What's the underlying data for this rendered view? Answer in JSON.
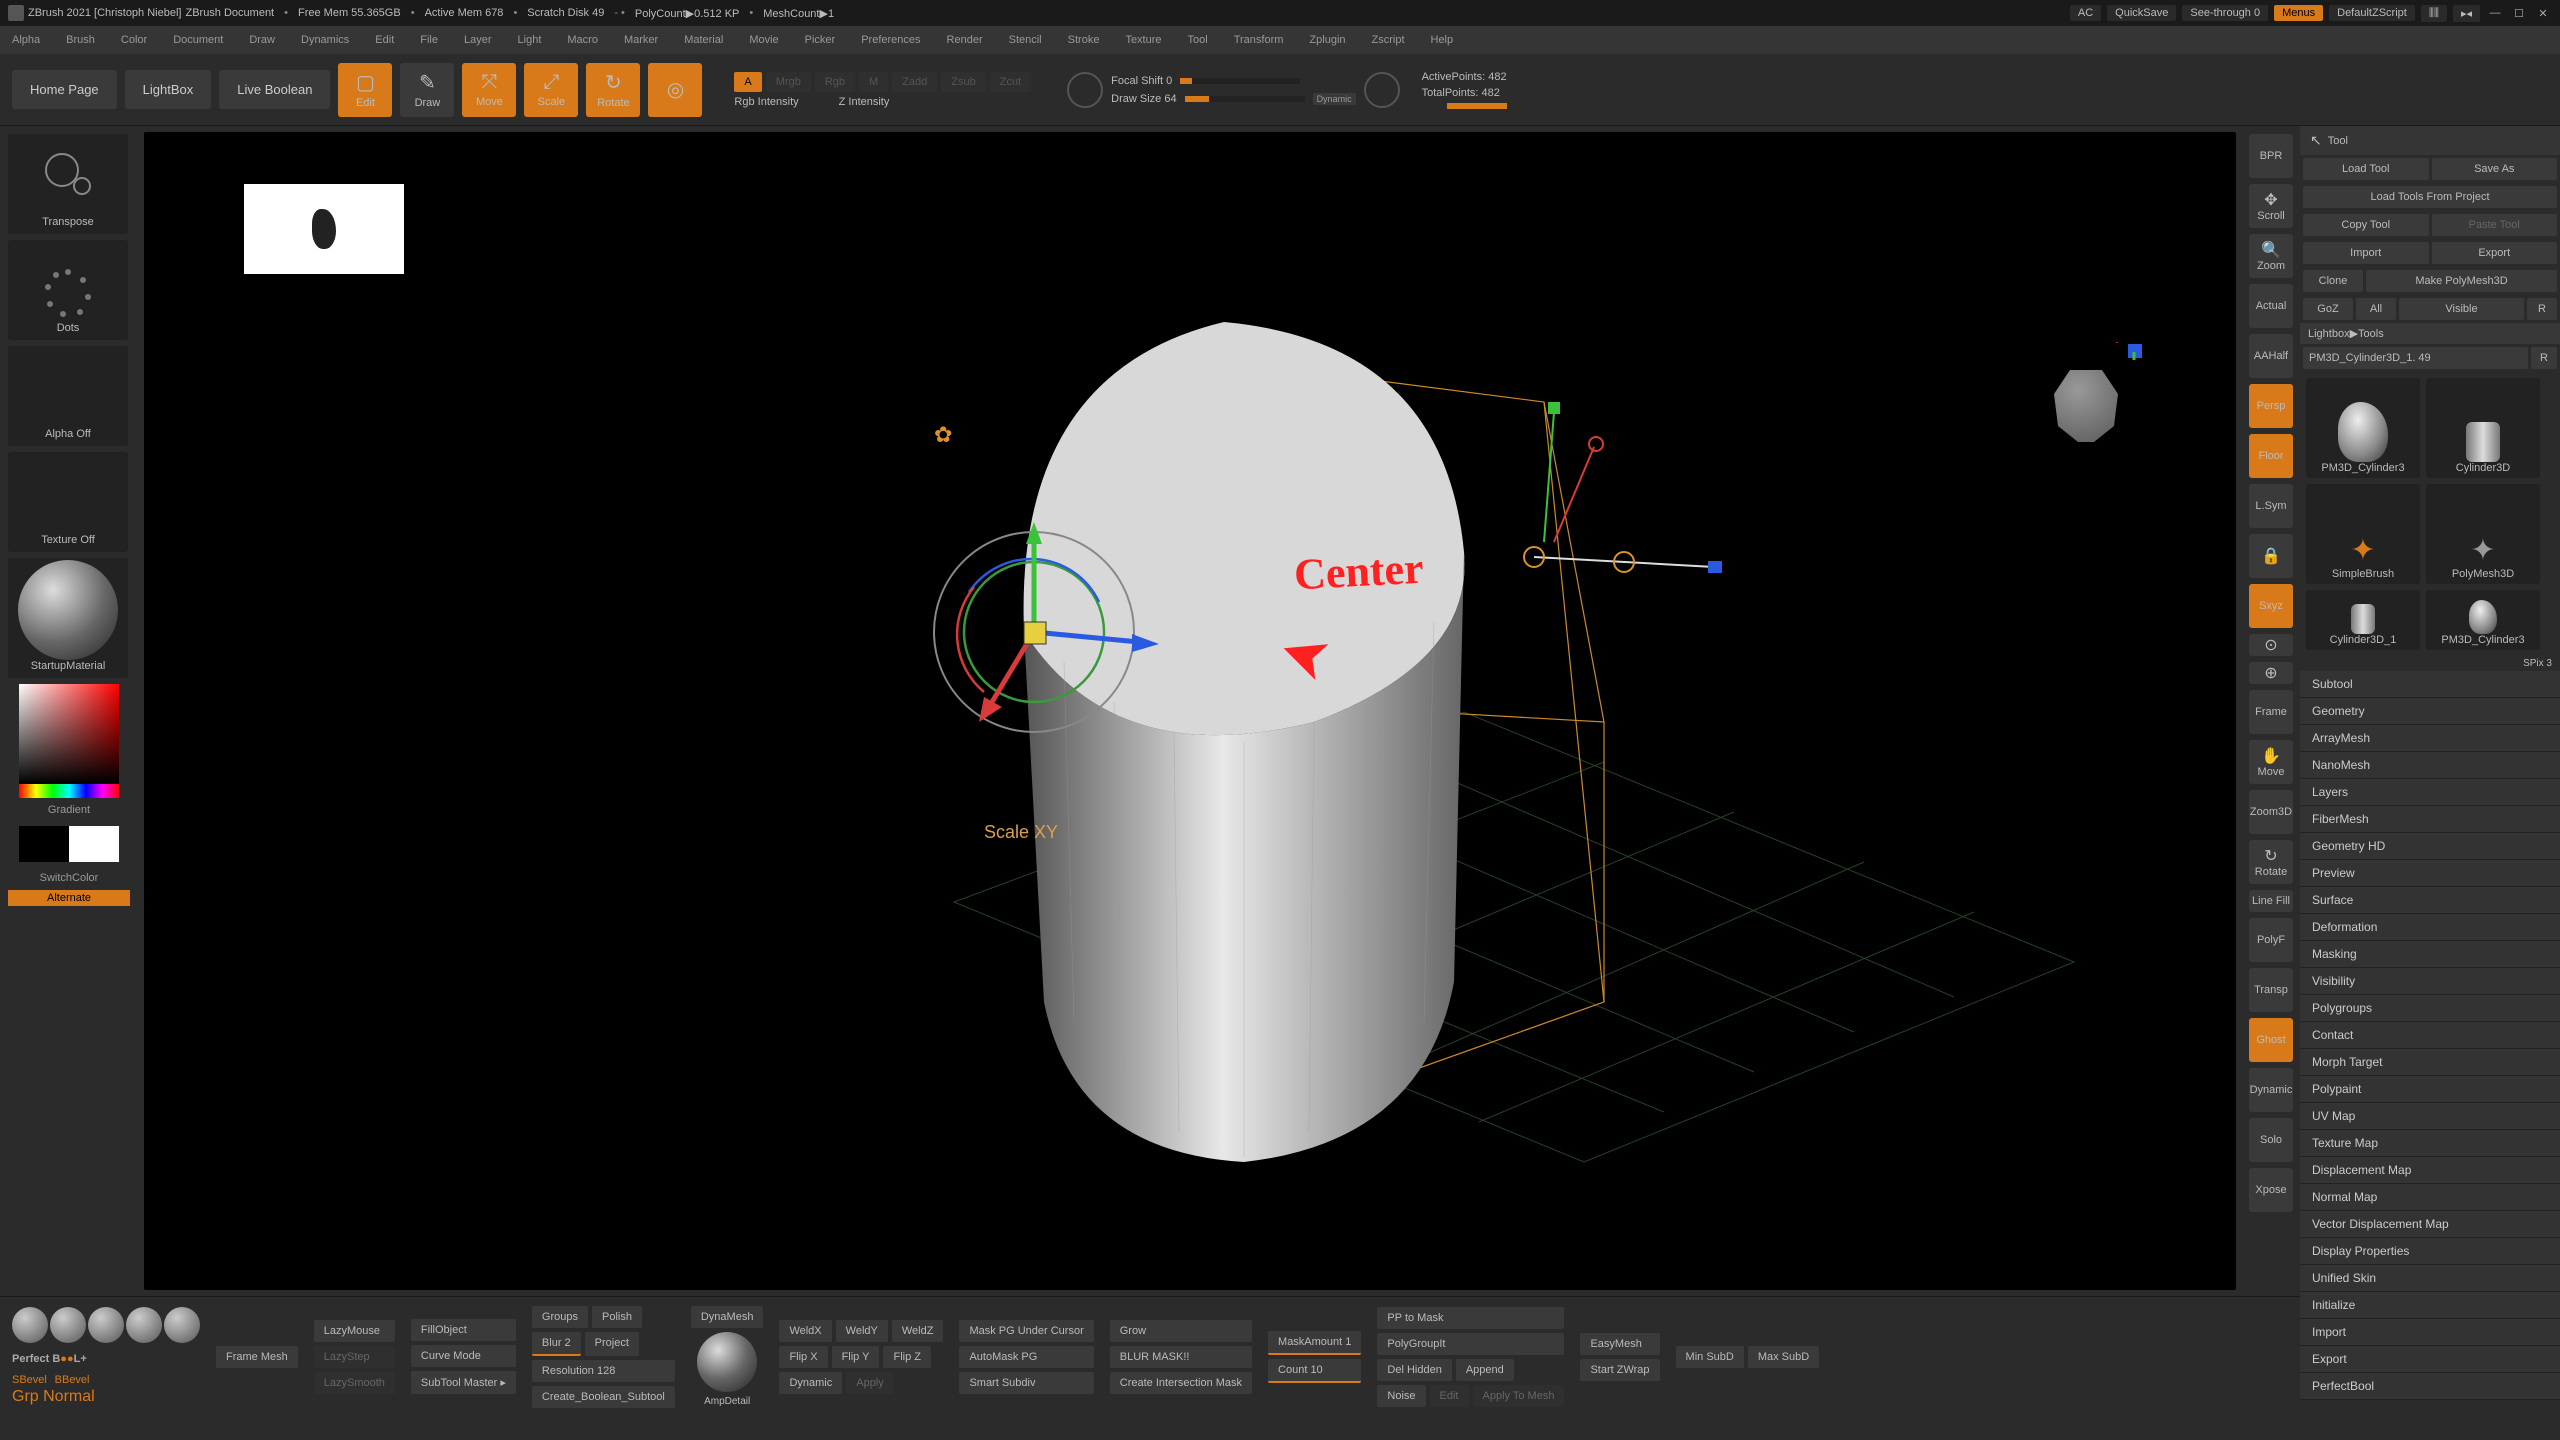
{
  "title": {
    "app": "ZBrush 2021 [Christoph Niebel]",
    "doc": "ZBrush Document",
    "freemem": "Free Mem 55.365GB",
    "activemem": "Active Mem 678",
    "scratch": "Scratch Disk 49",
    "polycount": "PolyCount▶0.512 KP",
    "meshcount": "MeshCount▶1",
    "ac": "AC",
    "quicksave": "QuickSave",
    "seethrough": "See-through  0",
    "menus": "Menus",
    "defaultscript": "DefaultZScript"
  },
  "menu": [
    "Alpha",
    "Brush",
    "Color",
    "Document",
    "Draw",
    "Dynamics",
    "Edit",
    "File",
    "Layer",
    "Light",
    "Macro",
    "Marker",
    "Material",
    "Movie",
    "Picker",
    "Preferences",
    "Render",
    "Stencil",
    "Stroke",
    "Texture",
    "Tool",
    "Transform",
    "Zplugin",
    "Zscript",
    "Help"
  ],
  "shelf": {
    "home": "Home Page",
    "lightbox": "LightBox",
    "liveboolean": "Live Boolean",
    "edit": "Edit",
    "draw": "Draw",
    "move": "Move",
    "scale": "Scale",
    "rotate": "Rotate",
    "gizmo": "⊙",
    "a": "A",
    "mrgb": "Mrgb",
    "rgb": "Rgb",
    "m": "M",
    "zadd": "Zadd",
    "zsub": "Zsub",
    "zcut": "Zcut",
    "rgbint": "Rgb Intensity",
    "zint": "Z Intensity",
    "focalshift": "Focal Shift 0",
    "drawsize": "Draw Size 64",
    "dynamic": "Dynamic",
    "activepts": "ActivePoints: 482",
    "totalpts": "TotalPoints: 482"
  },
  "left": {
    "transpose": "Transpose",
    "dots": "Dots",
    "alphaoff": "Alpha Off",
    "textureoff": "Texture Off",
    "material": "StartupMaterial",
    "gradient": "Gradient",
    "switchcolor": "SwitchColor",
    "alternate": "Alternate"
  },
  "viewbtns": [
    "BPR",
    "Scroll",
    "Zoom",
    "Actual",
    "AAHalf",
    "Persp",
    "Floor",
    "L.Sym",
    "⊗",
    "Sxyz",
    "⊙",
    "⊕",
    "Frame",
    "Move",
    "Zoom3D",
    "Rotate",
    "Line Fill",
    "PolyF",
    "Transp",
    "Ghost",
    "Dynamic",
    "Solo",
    "Xpose"
  ],
  "viewbtns_active": [
    5,
    6,
    9
  ],
  "tool": {
    "title": "Tool",
    "loadtool": "Load Tool",
    "saveas": "Save As",
    "loadproject": "Load Tools From Project",
    "copytool": "Copy Tool",
    "pastetool": "Paste Tool",
    "import": "Import",
    "export": "Export",
    "clone": "Clone",
    "makepoly": "Make PolyMesh3D",
    "goz": "GoZ",
    "all": "All",
    "visible": "Visible",
    "r": "R",
    "crumb": "Lightbox▶Tools",
    "current": "PM3D_Cylinder3D_1. 49",
    "tools": [
      "PM3D_Cylinder3",
      "Cylinder3D",
      "SimpleBrush",
      "PolyMesh3D",
      "Cylinder3D_1",
      "PM3D_Cylinder3"
    ],
    "spix": "SPix 3",
    "sections": [
      "Subtool",
      "Geometry",
      "ArrayMesh",
      "NanoMesh",
      "Layers",
      "FiberMesh",
      "Geometry HD",
      "Preview",
      "Surface",
      "Deformation",
      "Masking",
      "Visibility",
      "Polygroups",
      "Contact",
      "Morph Target",
      "Polypaint",
      "UV Map",
      "Texture Map",
      "Displacement Map",
      "Normal Map",
      "Vector Displacement Map",
      "Display Properties",
      "Unified Skin",
      "Initialize",
      "Import",
      "Export",
      "PerfectBool"
    ]
  },
  "viewport": {
    "annotation": "Center",
    "scalexy": "Scale XY"
  },
  "bottom": {
    "logo1": "Perfect B",
    "logo1b": "L+",
    "logo2a": "SBevel",
    "logo2b": "BBevel",
    "logo3": "Grp Normal",
    "framemesh": "Frame Mesh",
    "lazymouse": "LazyMouse",
    "lazystep": "LazyStep",
    "lazysmooth": "LazySmooth",
    "fillobject": "FillObject",
    "curvemode": "Curve Mode",
    "subtoolmaster": "SubTool Master ▸",
    "groups": "Groups",
    "polish": "Polish",
    "blur2": "Blur 2",
    "project": "Project",
    "resolution": "Resolution 128",
    "createboolean": "Create_Boolean_Subtool",
    "dynamesh": "DynaMesh",
    "ampdetail": "AmpDetail",
    "weldx": "WeldX",
    "weldy": "WeldY",
    "weldz": "WeldZ",
    "flipx": "Flip X",
    "flipy": "Flip Y",
    "flipz": "Flip Z",
    "dynamic": "Dynamic",
    "maskpg": "Mask PG Under Cursor",
    "automask": "AutoMask PG",
    "apply": "Apply",
    "grow": "Grow",
    "blurmask": "BLUR MASK!!",
    "createint": "Create Intersection Mask",
    "maskamount": "MaskAmount 1",
    "count": "Count 10",
    "pptomask": "PP to Mask",
    "polygroupit": "PolyGroupIt",
    "delhidden": "Del Hidden",
    "noise": "Noise",
    "smartsubdiv": "Smart Subdiv",
    "append": "Append",
    "edit": "Edit",
    "applytomesh": "Apply To Mesh",
    "easymesh": "EasyMesh",
    "startzwrap": "Start ZWrap",
    "minsubd": "Min SubD",
    "maxsubd": "Max SubD"
  }
}
